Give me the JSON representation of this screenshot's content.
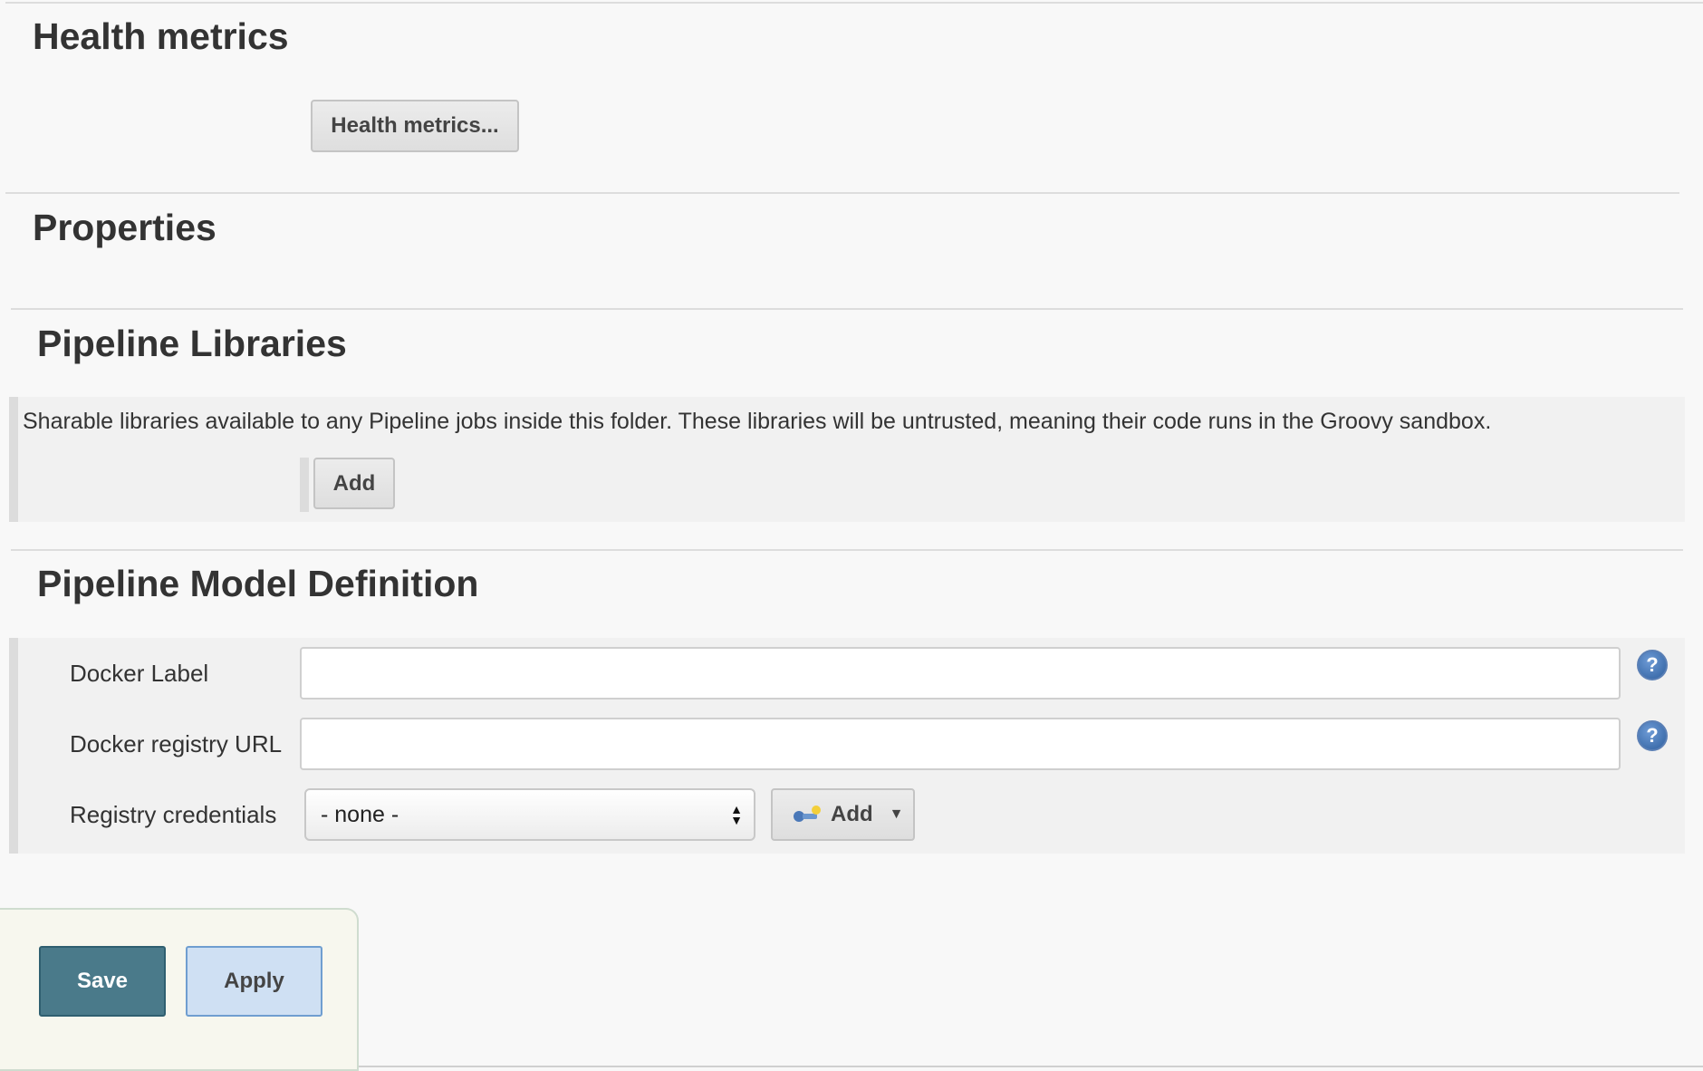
{
  "sections": {
    "health": {
      "title": "Health metrics",
      "button_label": "Health metrics..."
    },
    "properties": {
      "title": "Properties"
    },
    "libraries": {
      "title": "Pipeline Libraries",
      "description": "Sharable libraries available to any Pipeline jobs inside this folder. These libraries will be untrusted, meaning their code runs in the Groovy sandbox.",
      "add_label": "Add"
    },
    "model": {
      "title": "Pipeline Model Definition",
      "docker_label": {
        "label": "Docker Label",
        "value": ""
      },
      "registry_url": {
        "label": "Docker registry URL",
        "value": ""
      },
      "credentials": {
        "label": "Registry credentials",
        "selected": "- none -",
        "add_label": "Add"
      }
    }
  },
  "footer": {
    "save_label": "Save",
    "apply_label": "Apply"
  },
  "colors": {
    "save": "#4a7a8a",
    "apply": "#cfe0f3",
    "help_icon": "#2e5f9e"
  },
  "icons": {
    "help": "help-icon",
    "credentials": "key-icon",
    "dropdown": "caret-down-icon"
  }
}
